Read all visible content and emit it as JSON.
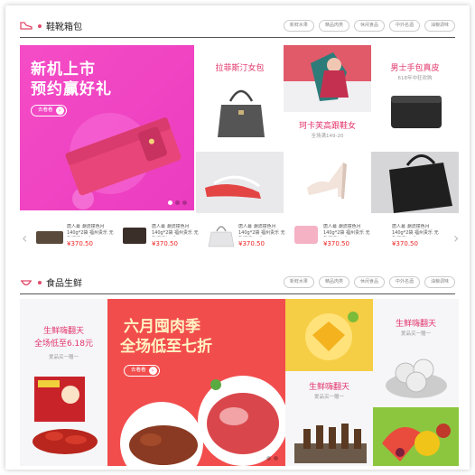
{
  "sections": {
    "bags": {
      "title": "鞋靴箱包",
      "tags": [
        "新鲜水果",
        "精品肉类",
        "休闲食品",
        "中外名酒",
        "油粮调味"
      ],
      "banner": {
        "line1": "新机上市",
        "line2": "预约赢好礼",
        "button": "去看看"
      },
      "cells": [
        {
          "title": "拉菲斯汀女包"
        },
        {
          "title": "男士手包真皮",
          "sub": "618年中狂欢购"
        },
        {
          "title": "珂卡芙高跟鞋女",
          "sub": "全场满149-20"
        }
      ],
      "strip": [
        {
          "name": "唐人幕 潮流撞色月140g*2袋 福州贵乐 无乳源添加 手工",
          "price": "¥370.50"
        },
        {
          "name": "唐人幕 潮流撞色月140g*2袋 福州贵乐 无乳源添加 手工",
          "price": "¥370.50"
        },
        {
          "name": "唐人幕 潮流撞色月140g*2袋 福州贵乐 无乳源添加 手工",
          "price": "¥370.50"
        },
        {
          "name": "唐人幕 潮流撞色月140g*2袋 福州贵乐 无乳源添加 手工",
          "price": "¥370.50"
        },
        {
          "name": "唐人幕 潮流撞色月140g*2袋 福州贵乐 无乳源添加 手工",
          "price": "¥370.50"
        }
      ]
    },
    "food": {
      "title": "食品生鲜",
      "tags": [
        "新鲜水果",
        "精品肉类",
        "休闲食品",
        "中外名酒",
        "油粮调味"
      ],
      "left": {
        "title": "生鲜嗨翻天",
        "promo": "全场低至6.18元",
        "sub": "爱品买一赠一"
      },
      "banner": {
        "line1": "六月囤肉季",
        "line2": "全场低至七折",
        "button": "去看看"
      },
      "cells": [
        {
          "title": "生鲜嗨翻天",
          "sub": "爱品买一赠一"
        },
        {
          "title": "生鲜嗨翻天",
          "sub": "爱品买一赠一"
        }
      ]
    }
  },
  "colors": {
    "accent": "#e2336b",
    "banner_pink": "#f04fbf",
    "banner_red": "#f04b4b"
  }
}
